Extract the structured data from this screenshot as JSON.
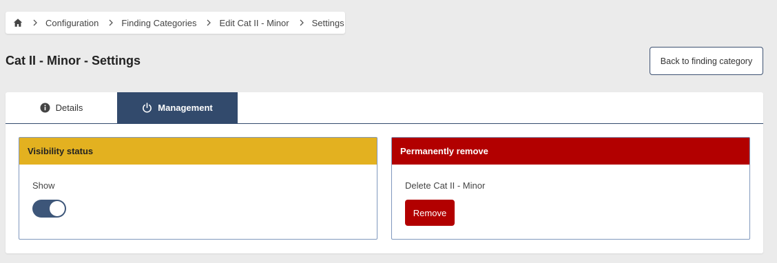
{
  "breadcrumb": {
    "home_icon": "home-icon",
    "items": [
      "Configuration",
      "Finding Categories",
      "Edit Cat II - Minor",
      "Settings"
    ]
  },
  "page": {
    "title": "Cat II - Minor - Settings",
    "back_button": "Back to finding category"
  },
  "tabs": [
    {
      "label": "Details",
      "icon": "info-icon",
      "active": false
    },
    {
      "label": "Management",
      "icon": "power-icon",
      "active": true
    }
  ],
  "visibility": {
    "header": "Visibility status",
    "label": "Show",
    "toggle_on": true
  },
  "remove": {
    "header": "Permanently remove",
    "text": "Delete Cat II - Minor",
    "button": "Remove"
  },
  "colors": {
    "accent": "#324a6c",
    "warning": "#e3b120",
    "danger": "#b20000"
  }
}
